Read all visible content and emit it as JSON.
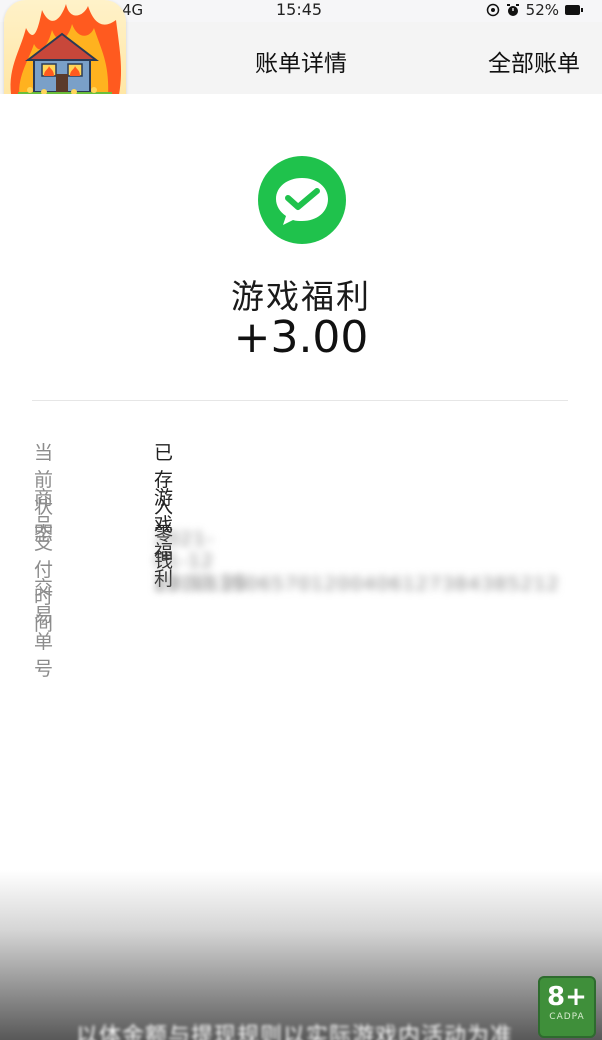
{
  "status_bar": {
    "signal": "4G",
    "time": "15:45",
    "battery": "52%"
  },
  "nav": {
    "title": "账单详情",
    "right_action": "全部账单"
  },
  "app_icon": {
    "name": "house-fire-game-icon"
  },
  "transaction": {
    "logo": "wechat-pay-icon",
    "title": "游戏福利",
    "amount": "+3.00"
  },
  "details": [
    {
      "label": "当前状态",
      "value": "已存入零钱",
      "blurred": false
    },
    {
      "label": "商品",
      "value": "游戏福利",
      "blurred": false
    },
    {
      "label": "支付时间",
      "value": "2021-01-12 23:53:30",
      "blurred": true
    },
    {
      "label": "交易单号",
      "value": "1010115065701200406127384385212",
      "blurred": true
    }
  ],
  "overlay": {
    "caption": "以体金额与提现规则以实际游戏内活动为准",
    "age_rating": "8+",
    "age_org": "CADPA"
  },
  "colors": {
    "wechat_green": "#1fc24c",
    "background": "#f6f6f8"
  }
}
